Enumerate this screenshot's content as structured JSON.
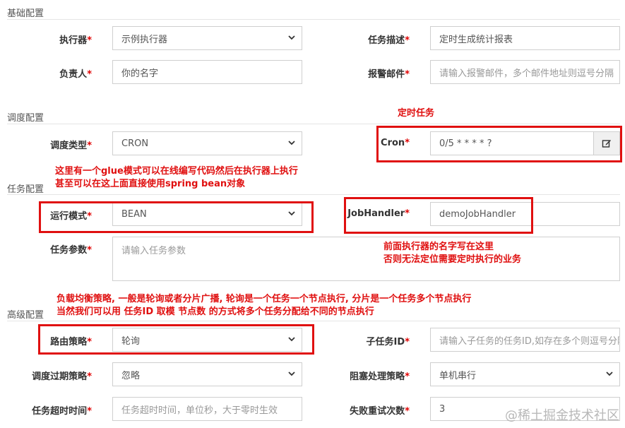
{
  "sections": {
    "basic": "基础配置",
    "schedule": "调度配置",
    "task": "任务配置",
    "advanced": "高级配置"
  },
  "required_mark": "*",
  "fields": {
    "executor": {
      "label": "执行器",
      "value": "示例执行器"
    },
    "task_desc": {
      "label": "任务描述",
      "value": "定时生成统计报表"
    },
    "owner": {
      "label": "负责人",
      "value": "你的名字"
    },
    "alarm_email": {
      "label": "报警邮件",
      "placeholder": "请输入报警邮件，多个邮件地址则逗号分隔"
    },
    "schedule_type": {
      "label": "调度类型",
      "value": "CRON"
    },
    "cron": {
      "label": "Cron",
      "value": "0/5 * * * * ?"
    },
    "run_mode": {
      "label": "运行模式",
      "value": "BEAN"
    },
    "job_handler": {
      "label": "JobHandler",
      "value": "demoJobHandler"
    },
    "task_params": {
      "label": "任务参数",
      "placeholder": "请输入任务参数"
    },
    "route_strategy": {
      "label": "路由策略",
      "value": "轮询"
    },
    "child_job_id": {
      "label": "子任务ID",
      "placeholder": "请输入子任务的任务ID,如存在多个则逗号分隔"
    },
    "misfire_strategy": {
      "label": "调度过期策略",
      "value": "忽略"
    },
    "block_strategy": {
      "label": "阻塞处理策略",
      "value": "单机串行"
    },
    "timeout": {
      "label": "任务超时时间",
      "placeholder": "任务超时时间，单位秒，大于零时生效"
    },
    "fail_retry": {
      "label": "失败重试次数",
      "value": "3"
    }
  },
  "annotations": {
    "cron_note": "定时任务",
    "glue_note_1": "这里有一个glue模式可以在线编写代码然后在执行器上执行",
    "glue_note_2": "甚至可以在这上面直接使用spring bean对象",
    "handler_note_1": "前面执行器的名字写在这里",
    "handler_note_2": "否则无法定位需要定时执行的业务",
    "route_note_1": "负载均衡策略, 一般是轮询或者分片广播, 轮询是一个任务一个节点执行, 分片是一个任务多个节点执行",
    "route_note_2": "当然我们可以用 任务ID 取模 节点数 的方式将多个任务分配给不同的节点执行"
  },
  "watermark": "@稀土掘金技术社区",
  "icons": {
    "dropdown": "chevron-down-icon",
    "cron_edit": "edit-icon"
  },
  "colors": {
    "annotation_red": "#e01010",
    "required_red": "#e00000"
  }
}
